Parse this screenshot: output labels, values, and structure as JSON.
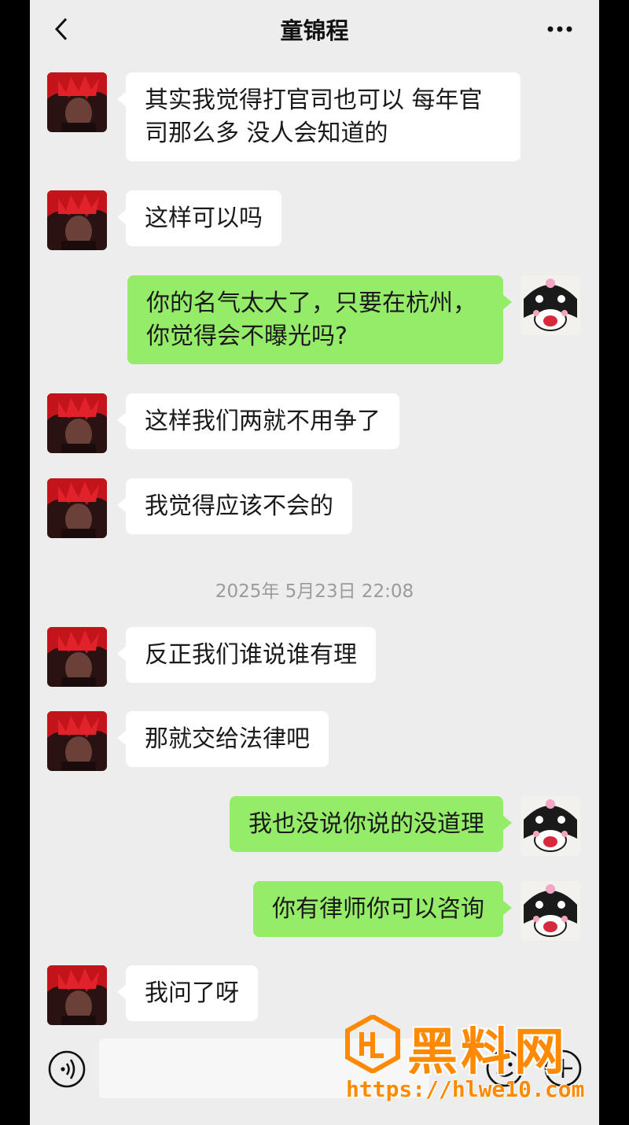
{
  "header": {
    "title": "童锦程",
    "back_icon": "chevron-left-icon",
    "more_icon": "more-dots-icon"
  },
  "messages": [
    {
      "side": "in",
      "text": "其实我觉得打官司也可以 每年官司那么多 没人会知道的"
    },
    {
      "side": "in",
      "text": "这样可以吗"
    },
    {
      "side": "out",
      "text": "你的名气太大了，只要在杭州，你觉得会不曝光吗?"
    },
    {
      "side": "in",
      "text": "这样我们两就不用争了"
    },
    {
      "side": "in",
      "text": "我觉得应该不会的"
    },
    {
      "side": "in",
      "text": "反正我们谁说谁有理"
    },
    {
      "side": "in",
      "text": "那就交给法律吧"
    },
    {
      "side": "out",
      "text": "我也没说你说的没道理"
    },
    {
      "side": "out",
      "text": "你有律师你可以咨询"
    },
    {
      "side": "in",
      "text": "我问了呀"
    }
  ],
  "timestamp": "2025年 5月23日 22:08",
  "input_bar": {
    "voice_icon": "voice-icon",
    "input_value": "",
    "emoji_icon": "emoji-icon",
    "plus_icon": "plus-icon"
  },
  "watermark": {
    "text": "黑料网",
    "url": "https://hlwe10.com"
  },
  "colors": {
    "incoming_bubble": "#ffffff",
    "outgoing_bubble": "#95ec69",
    "background": "#ededed",
    "watermark": "#ff8a00"
  }
}
